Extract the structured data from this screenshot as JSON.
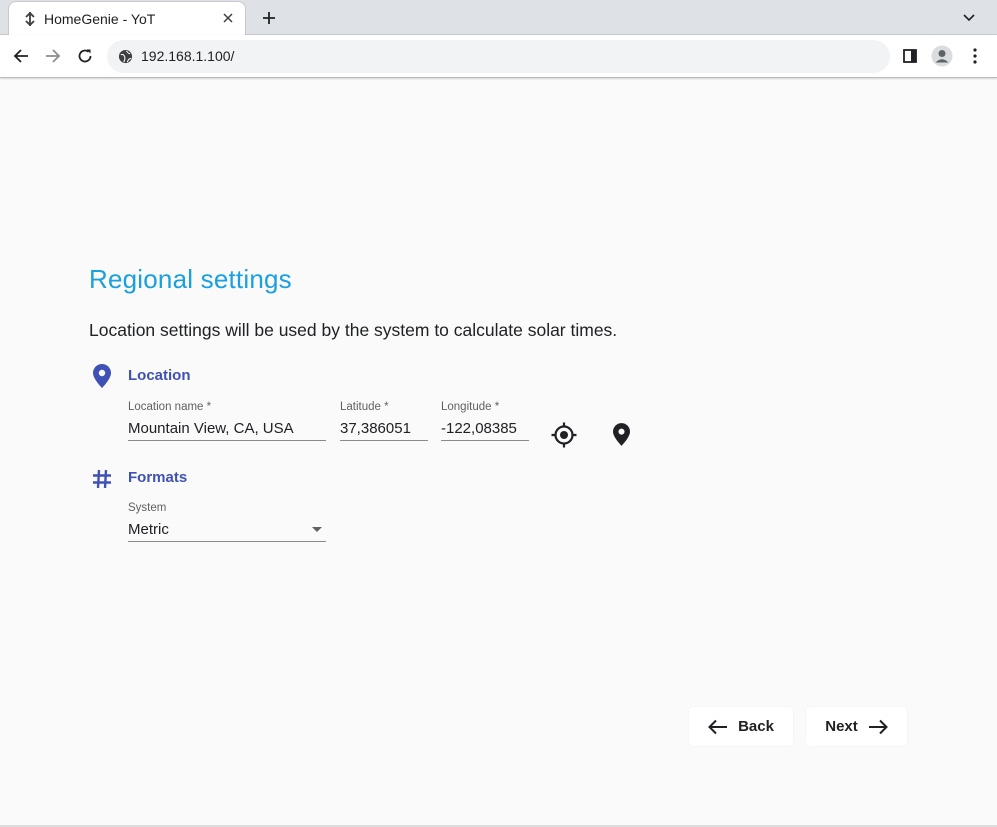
{
  "browser": {
    "tab_title": "HomeGenie - YoT",
    "url": "192.168.1.100/"
  },
  "page": {
    "title": "Regional settings",
    "description": "Location settings will be used by the system to calculate solar times."
  },
  "location": {
    "section_label": "Location",
    "name_label": "Location name *",
    "name_value": "Mountain View, CA, USA",
    "latitude_label": "Latitude *",
    "latitude_value": "37,386051",
    "longitude_label": "Longitude *",
    "longitude_value": "-122,08385"
  },
  "formats": {
    "section_label": "Formats",
    "system_label": "System",
    "system_value": "Metric"
  },
  "actions": {
    "back_label": "Back",
    "next_label": "Next"
  },
  "colors": {
    "title": "#1aa0e0",
    "accent": "#3f51b5"
  }
}
